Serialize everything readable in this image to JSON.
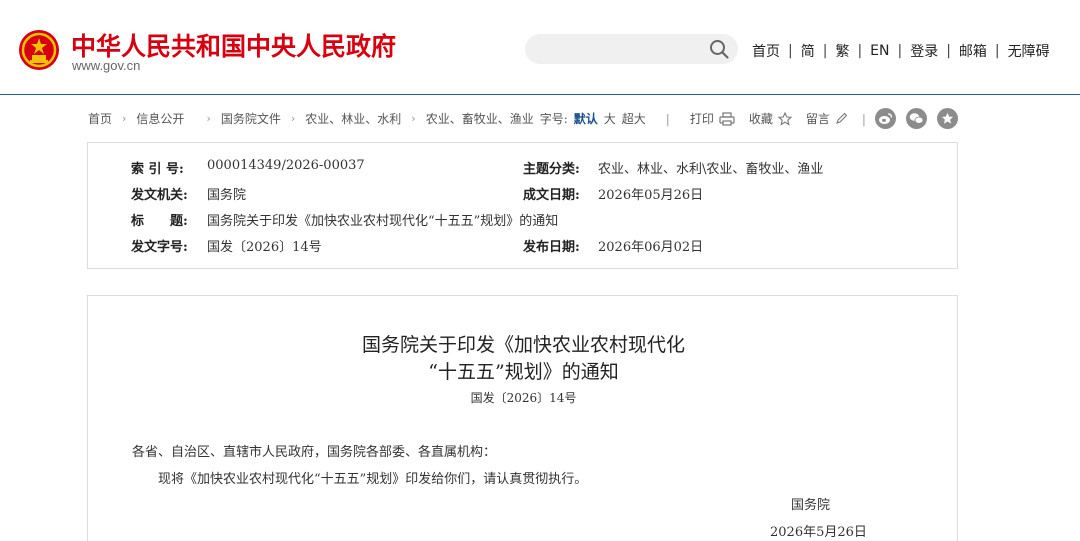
{
  "header": {
    "site_title": "中华人民共和国中央人民政府",
    "site_url": "www.gov.cn",
    "search_placeholder": "",
    "nav": [
      "首页",
      "简",
      "繁",
      "EN",
      "登录",
      "邮箱",
      "无障碍"
    ],
    "nav_separator": "|"
  },
  "breadcrumb": {
    "items": [
      "首页",
      "信息公开",
      "国务院文件",
      "农业、林业、水利",
      "农业、畜牧业、渔业"
    ],
    "fontsize_label": "字号:",
    "fontsize_options": [
      "默认",
      "大",
      "超大"
    ],
    "tools": [
      "打印",
      "收藏",
      "留言"
    ]
  },
  "share_icons": [
    "weibo-icon",
    "wechat-icon",
    "star-icon"
  ],
  "info": {
    "index_label": "索 引 号:",
    "index_value": "000014349/2026-00037",
    "topic_label": "主题分类:",
    "topic_value": "农业、林业、水利\\农业、畜牧业、渔业",
    "issuer_label": "发文机关:",
    "issuer_value": "国务院",
    "written_label": "成文日期:",
    "written_value": "2026年05月26日",
    "title_label": "标　　题:",
    "title_value": "国务院关于印发《加快农业农村现代化“十五五”规划》的通知",
    "docno_label": "发文字号:",
    "docno_value": "国发〔2026〕14号",
    "published_label": "发布日期:",
    "published_value": "2026年06月02日"
  },
  "article": {
    "title_line1": "国务院关于印发《加快农业农村现代化",
    "title_line2": "“十五五”规划》的通知",
    "doc_number": "国发〔2026〕14号",
    "salutation": "各省、自治区、直辖市人民政府，国务院各部委、各直属机构：",
    "body": "现将《加快农业农村现代化“十五五”规划》印发给你们，请认真贯彻执行。",
    "signature": "国务院",
    "date": "2026年5月26日"
  },
  "colors": {
    "brand_red": "#d7000f",
    "header_line": "#2a5b8f",
    "active_fontsize": "#1b4f8c"
  }
}
